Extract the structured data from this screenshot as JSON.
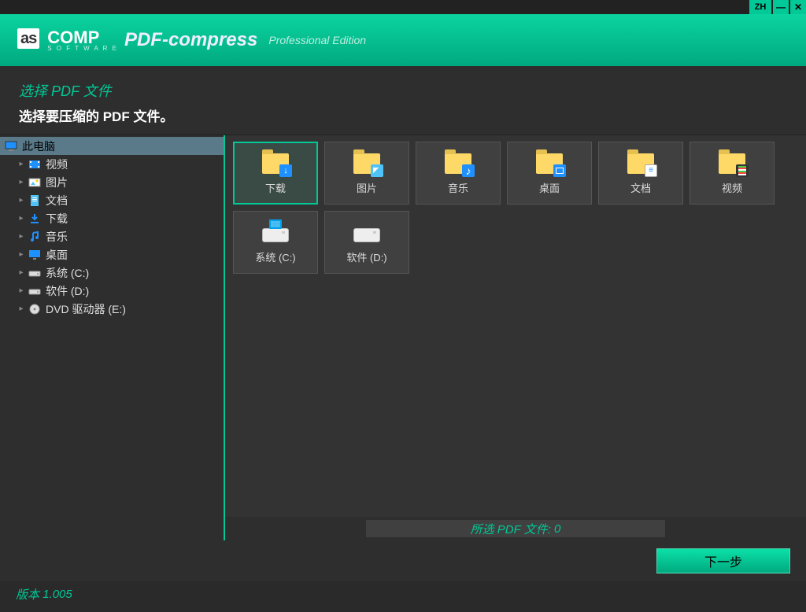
{
  "titlebar": {
    "lang": "ZH",
    "min": "—",
    "close": "✕"
  },
  "branding": {
    "box": "as",
    "comp": "COMP",
    "soft": "S O F T W A R E",
    "product": "PDF-compress",
    "edition": "Professional Edition"
  },
  "headings": {
    "title": "选择 PDF 文件",
    "subtitle": "选择要压缩的 PDF 文件。"
  },
  "tree": {
    "root": "此电脑",
    "items": [
      {
        "label": "视频",
        "icon": "video"
      },
      {
        "label": "图片",
        "icon": "photo"
      },
      {
        "label": "文档",
        "icon": "doc"
      },
      {
        "label": "下载",
        "icon": "download"
      },
      {
        "label": "音乐",
        "icon": "music"
      },
      {
        "label": "桌面",
        "icon": "desktop"
      },
      {
        "label": "系统 (C:)",
        "icon": "drive"
      },
      {
        "label": "软件 (D:)",
        "icon": "drive"
      },
      {
        "label": "DVD 驱动器 (E:)",
        "icon": "disc"
      }
    ]
  },
  "grid": [
    {
      "label": "下载",
      "type": "folder",
      "overlay": "arrow",
      "selected": true
    },
    {
      "label": "图片",
      "type": "folder",
      "overlay": "photo"
    },
    {
      "label": "音乐",
      "type": "folder",
      "overlay": "note"
    },
    {
      "label": "桌面",
      "type": "folder",
      "overlay": "screen"
    },
    {
      "label": "文档",
      "type": "folder",
      "overlay": "doc"
    },
    {
      "label": "视频",
      "type": "folder",
      "overlay": "film"
    },
    {
      "label": "系统 (C:)",
      "type": "drive",
      "badge": true
    },
    {
      "label": "软件 (D:)",
      "type": "drive"
    }
  ],
  "status": {
    "prefix": "所选 PDF 文件:",
    "count": "0"
  },
  "footer": {
    "next": "下一步"
  },
  "version": {
    "label": "版本",
    "num": "1.005"
  }
}
